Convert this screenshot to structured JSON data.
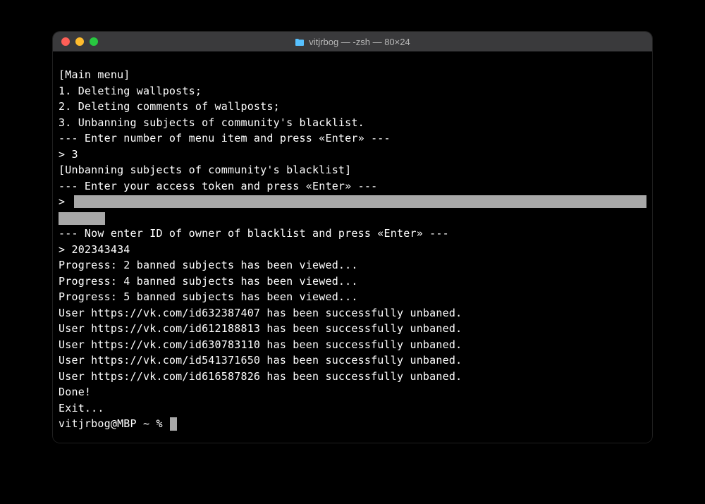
{
  "window": {
    "title": "vitjrbog — -zsh — 80×24"
  },
  "terminal": {
    "lines": {
      "l0": "[Main menu]",
      "l1": "1. Deleting wallposts;",
      "l2": "2. Deleting comments of wallposts;",
      "l3": "3. Unbanning subjects of community's blacklist.",
      "l4": "--- Enter number of menu item and press «Enter» ---",
      "l5": "> 3",
      "l6": "[Unbanning subjects of community's blacklist]",
      "l7": "--- Enter your access token and press «Enter» ---",
      "l8_prefix": "> ",
      "l9": "--- Now enter ID of owner of blacklist and press «Enter» ---",
      "l10": "> 202343434",
      "l11": "Progress: 2 banned subjects has been viewed...",
      "l12": "Progress: 4 banned subjects has been viewed...",
      "l13": "Progress: 5 banned subjects has been viewed...",
      "l14": "User https://vk.com/id632387407 has been successfully unbaned.",
      "l15": "User https://vk.com/id612188813 has been successfully unbaned.",
      "l16": "User https://vk.com/id630783110 has been successfully unbaned.",
      "l17": "User https://vk.com/id541371650 has been successfully unbaned.",
      "l18": "User https://vk.com/id616587826 has been successfully unbaned.",
      "l19": "Done!",
      "l20": "Exit...",
      "l21_prompt": "vitjrbog@MBP ~ % "
    }
  }
}
